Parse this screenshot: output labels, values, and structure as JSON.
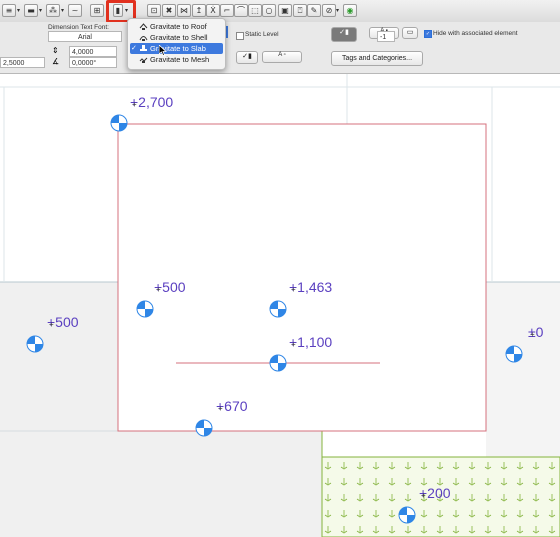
{
  "toolbar": {
    "buttons": [
      "layer-icon",
      "pen-icon",
      "fill-icon",
      "pattern-icon",
      "ruler-icon",
      "gravity-icon",
      "grid-icon",
      "magic-wand-icon",
      "cut-icon",
      "elevation-icon",
      "line-icon",
      "curve-icon",
      "arc-icon",
      "circle-icon",
      "polyline-icon",
      "guide-icon",
      "snap-icon",
      "pencil-icon",
      "eyedropper-icon",
      "pet-palette-icon",
      "target-icon"
    ]
  },
  "info_panel": {
    "dimension_font_label": "Dimension Text Font:",
    "font_value": "Arial",
    "size_value": "4,0000",
    "angle_value": "0,0000°",
    "scale_value": "2,5000",
    "static_level_label": "Static Level",
    "minus_value": "-1",
    "hide_label": "Hide with associated element",
    "tags_button": "Tags and Categories..."
  },
  "gravity_menu": {
    "items": [
      {
        "label": "Gravitate to Roof",
        "icon": "roof-gravity-icon",
        "checked": false,
        "selected": false
      },
      {
        "label": "Gravitate to Shell",
        "icon": "shell-gravity-icon",
        "checked": false,
        "selected": false
      },
      {
        "label": "Gravitate to Slab",
        "icon": "slab-gravity-icon",
        "checked": true,
        "selected": true
      },
      {
        "label": "Gravitate to Mesh",
        "icon": "mesh-gravity-icon",
        "checked": false,
        "selected": false
      }
    ],
    "checkmark": "✓"
  },
  "elevations": {
    "top": "+2,700",
    "left_inner": "+500",
    "center_upper": "+1,463",
    "center": "+1,100",
    "left_outer": "+500",
    "bottom": "+670",
    "right": "±0",
    "mesh": "+200"
  },
  "colors": {
    "accent": "#3d79de",
    "highlight_box": "#e1311f",
    "elevation_text": "#5a3fc0",
    "marker_blue": "#2f86e6",
    "slab_outline": "#d4707c",
    "mesh_green": "#84b33c"
  }
}
